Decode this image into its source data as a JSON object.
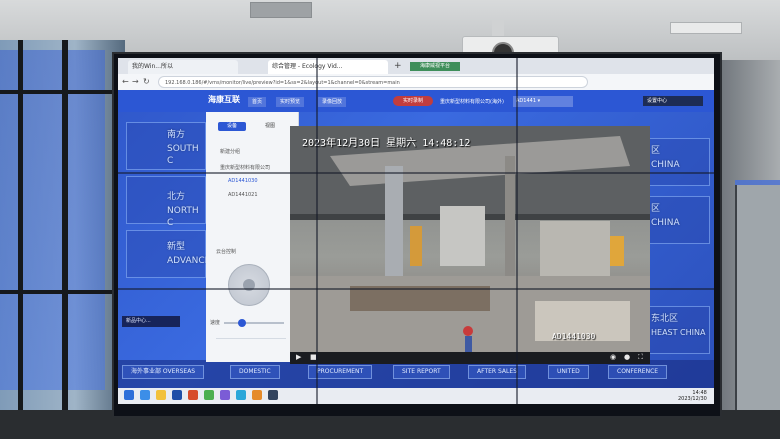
{
  "browser": {
    "tab1_title": "我的Win...所以",
    "tab2_title": "综合管理 - Ecology Vid...",
    "new_tab": "+",
    "tab_badge": "海康威视平台",
    "address": "192.168.0.186/#/vms/monitor/live/preview?id=1&ss=2&layout=1&channel=0&stream=main",
    "nav_back": "←",
    "nav_forward": "→",
    "nav_reload": "↻"
  },
  "app": {
    "logo": "海康互联",
    "tabs": [
      "首页",
      "实时预览",
      "录像回放"
    ],
    "status_pill": "实时录制",
    "org_select": "重庆新型材料有限公司(海外)",
    "camera_select": "AD1441 ▾",
    "user_area": "设置中心"
  },
  "panel": {
    "tab_active": "设备",
    "tab_inactive": "视图",
    "items": [
      "新建分组",
      "重庆新型材料有限公司",
      "AD1441030",
      "AD1441021"
    ],
    "ptz_label": "云台控制",
    "zoom_label": "速度"
  },
  "video": {
    "osd_timestamp": "2023年12月30日 星期六 14:48:12",
    "camera_id": "AD1441030"
  },
  "dashboard": {
    "left_labels": [
      {
        "cn": "南方",
        "en": "SOUTH C"
      },
      {
        "cn": "北方",
        "en": "NORTH C"
      },
      {
        "cn": "新型",
        "en": "ADVANCE"
      }
    ],
    "right_labels": [
      "区",
      "CHINA",
      "区",
      "CHINA",
      "东北区",
      "HEAST CHINA"
    ],
    "bottom_tabs": [
      "海外事业部 OVERSEAS",
      "DOMESTIC",
      "PROCUREMENT",
      "SITE REPORT",
      "AFTER SALES",
      "UNITED",
      "CONFERENCE"
    ],
    "chip": "新品中心..."
  },
  "taskbar": {
    "time": "14:48",
    "date": "2023/12/30"
  },
  "colors": {
    "app_blue": "#2c57d4",
    "dashboard_blue": "#3a6ae0",
    "status_red": "#c23d3d"
  }
}
